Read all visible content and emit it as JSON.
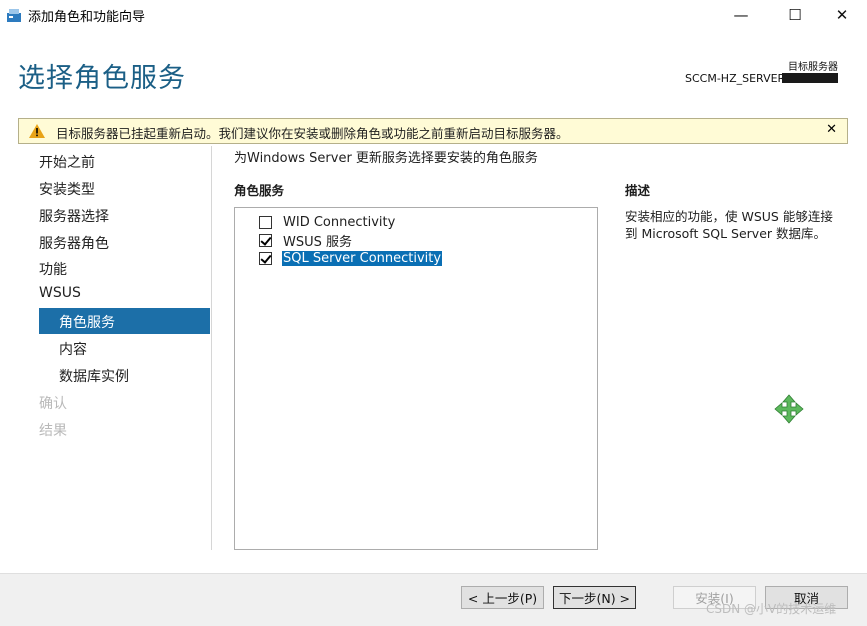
{
  "window": {
    "title": "添加角色和功能向导",
    "controls": {
      "minimize": "—",
      "maximize": "☐",
      "close": "✕"
    }
  },
  "header": {
    "page_title": "选择角色服务",
    "target_label": "目标服务器",
    "target_server": "SCCM-HZ_SERVER"
  },
  "warning": {
    "text": "目标服务器已挂起重新启动。我们建议你在安装或删除角色或功能之前重新启动目标服务器。",
    "close": "✕"
  },
  "nav": {
    "items": [
      {
        "label": "开始之前",
        "state": "normal"
      },
      {
        "label": "安装类型",
        "state": "normal"
      },
      {
        "label": "服务器选择",
        "state": "normal"
      },
      {
        "label": "服务器角色",
        "state": "normal"
      },
      {
        "label": "功能",
        "state": "normal"
      },
      {
        "label": "WSUS",
        "state": "normal"
      },
      {
        "label": "角色服务",
        "state": "active"
      },
      {
        "label": "内容",
        "state": "normal"
      },
      {
        "label": "数据库实例",
        "state": "normal"
      },
      {
        "label": "确认",
        "state": "disabled"
      },
      {
        "label": "结果",
        "state": "disabled"
      }
    ]
  },
  "main": {
    "instruction": "为Windows Server 更新服务选择要安装的角色服务",
    "role_services_heading": "角色服务",
    "role_services": [
      {
        "label": "WID Connectivity",
        "checked": false,
        "selected": false
      },
      {
        "label": "WSUS 服务",
        "checked": true,
        "selected": false
      },
      {
        "label": "SQL Server Connectivity",
        "checked": true,
        "selected": true
      }
    ],
    "description_heading": "描述",
    "description": "安装相应的功能，使 WSUS 能够连接到 Microsoft SQL Server 数据库。"
  },
  "footer": {
    "prev": "< 上一步(P)",
    "next": "下一步(N) >",
    "install": "安装(I)",
    "cancel": "取消"
  },
  "watermark": "CSDN @小V的技术运维",
  "colors": {
    "accent": "#1c6fa8",
    "title": "#1b5f86",
    "warning_bg": "#fffbd6",
    "selection": "#0a6fb4"
  }
}
